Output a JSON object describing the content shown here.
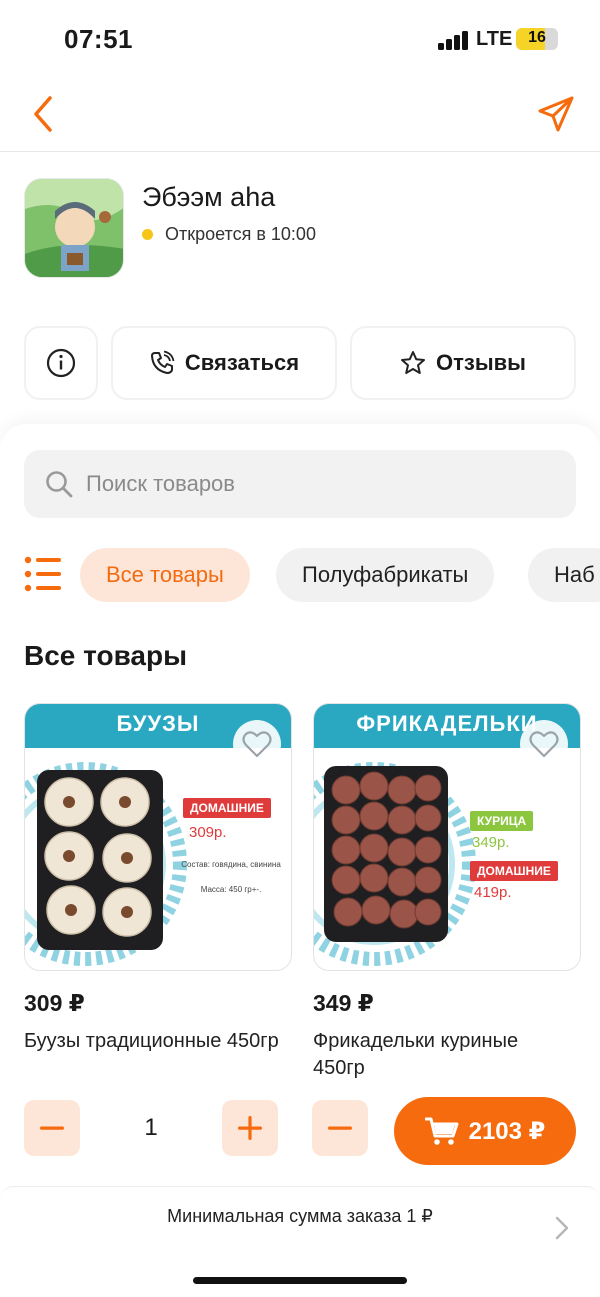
{
  "status_bar": {
    "time": "07:51",
    "network": "LTE",
    "battery": "16"
  },
  "shop": {
    "name": "Эбээм аhа",
    "status": "Откроется в 10:00"
  },
  "actions": {
    "contact_label": "Связаться",
    "reviews_label": "Отзывы"
  },
  "search": {
    "placeholder": "Поиск товаров"
  },
  "categories": [
    "Все товары",
    "Полуфабрикаты",
    "Наб"
  ],
  "section_title": "Все товары",
  "products": [
    {
      "banner": "БУУЗЫ",
      "tag": "ДОМАШНИЕ",
      "tag_price": "309р.",
      "composition": "Состав: говядина, свинина",
      "mass": "Масса: 450 гр+-.",
      "price": "309 ₽",
      "name": "Буузы традиционные 450гр",
      "quantity": "1"
    },
    {
      "banner": "ФРИКАДЕЛЬКИ",
      "tag1": "КУРИЦА",
      "tag1_price": "349р.",
      "tag2": "ДОМАШНИЕ",
      "tag2_price": "419р.",
      "price": "349 ₽",
      "name": "Фрикадельки куриные 450гр"
    }
  ],
  "cart": {
    "total": "2103 ₽"
  },
  "min_order": {
    "text": "Минимальная сумма заказа 1 ₽"
  },
  "colors": {
    "accent": "#f56b0d",
    "accent_light": "#fde6d8",
    "banner": "#2aa8c2",
    "status_dot": "#f5c518"
  },
  "icons": [
    "back-icon",
    "send-icon",
    "info-icon",
    "phone-icon",
    "star-icon",
    "search-icon",
    "list-icon",
    "heart-icon",
    "minus-icon",
    "plus-icon",
    "cart-icon",
    "chevron-right-icon"
  ]
}
